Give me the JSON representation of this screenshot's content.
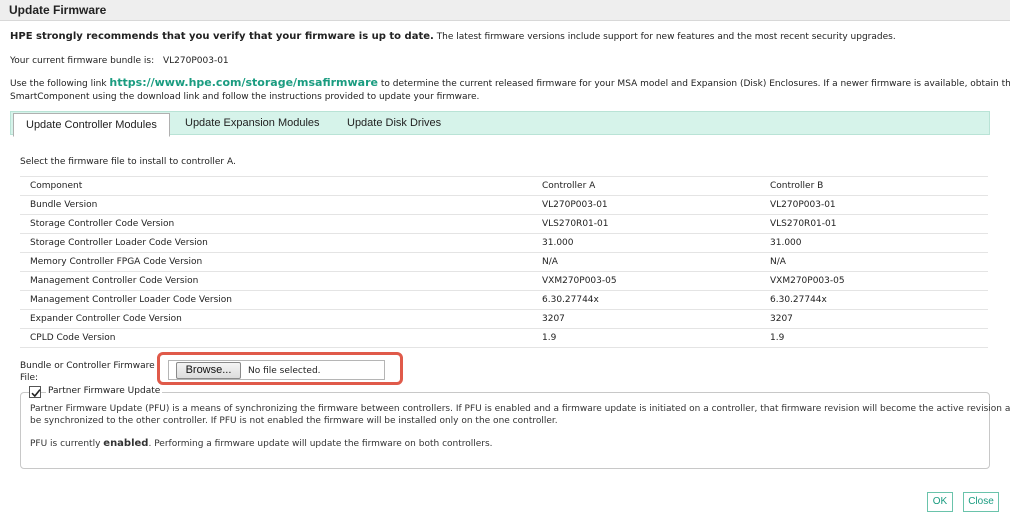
{
  "window": {
    "title": "Update Firmware"
  },
  "recommendation": {
    "strong": "HPE strongly recommends that you verify that your firmware is up to date.",
    "rest": "The latest firmware versions include support for new features and the most recent security upgrades."
  },
  "current_bundle": {
    "label": "Your current firmware bundle is:",
    "value": "VL270P003-01"
  },
  "instructions": {
    "prefix": "Use the following link",
    "link": "https://www.hpe.com/storage/msafirmware",
    "suffix": "to determine the current released firmware for your MSA model and Expansion (Disk) Enclosures. If a newer firmware is available, obtain the HPE",
    "line2": "SmartComponent using the download link and follow the instructions provided to update your firmware."
  },
  "tabs": [
    {
      "label": "Update Controller Modules",
      "active": true
    },
    {
      "label": "Update Expansion Modules",
      "active": false
    },
    {
      "label": "Update Disk Drives",
      "active": false
    }
  ],
  "select_prompt": "Select the firmware file to install to controller A.",
  "table": {
    "headers": [
      "Component",
      "Controller A",
      "Controller B"
    ],
    "rows": [
      [
        "Bundle Version",
        "VL270P003-01",
        "VL270P003-01"
      ],
      [
        "Storage Controller Code Version",
        "VLS270R01-01",
        "VLS270R01-01"
      ],
      [
        "Storage Controller Loader Code Version",
        "31.000",
        "31.000"
      ],
      [
        "Memory Controller FPGA Code Version",
        "N/A",
        "N/A"
      ],
      [
        "Management Controller Code Version",
        "VXM270P003-05",
        "VXM270P003-05"
      ],
      [
        "Management Controller Loader Code Version",
        "6.30.27744x",
        "6.30.27744x"
      ],
      [
        "Expander Controller Code Version",
        "3207",
        "3207"
      ],
      [
        "CPLD Code Version",
        "1.9",
        "1.9"
      ]
    ]
  },
  "file_field": {
    "label_line1": "Bundle or Controller Firmware",
    "label_line2": "File:",
    "browse_label": "Browse...",
    "status": "No file selected."
  },
  "pfu": {
    "checkbox_label": "Partner Firmware Update",
    "checked": true,
    "para1_line1": "Partner Firmware Update (PFU) is a means of synchronizing the firmware between controllers. If PFU is enabled and a firmware update is initiated on a controller, that firmware revision will become the active revision and will",
    "para1_line2": "be synchronized to the other controller. If PFU is not enabled the firmware will be installed only on the one controller.",
    "status_prefix": "PFU is currently",
    "status_value": "enabled",
    "status_suffix": ". Performing a firmware update will update the firmware on both controllers."
  },
  "buttons": {
    "ok": "OK",
    "close": "Close"
  },
  "colors": {
    "accent": "#1a9c80",
    "tab_bar": "#d6f3ea",
    "highlight": "#e05a4a"
  }
}
